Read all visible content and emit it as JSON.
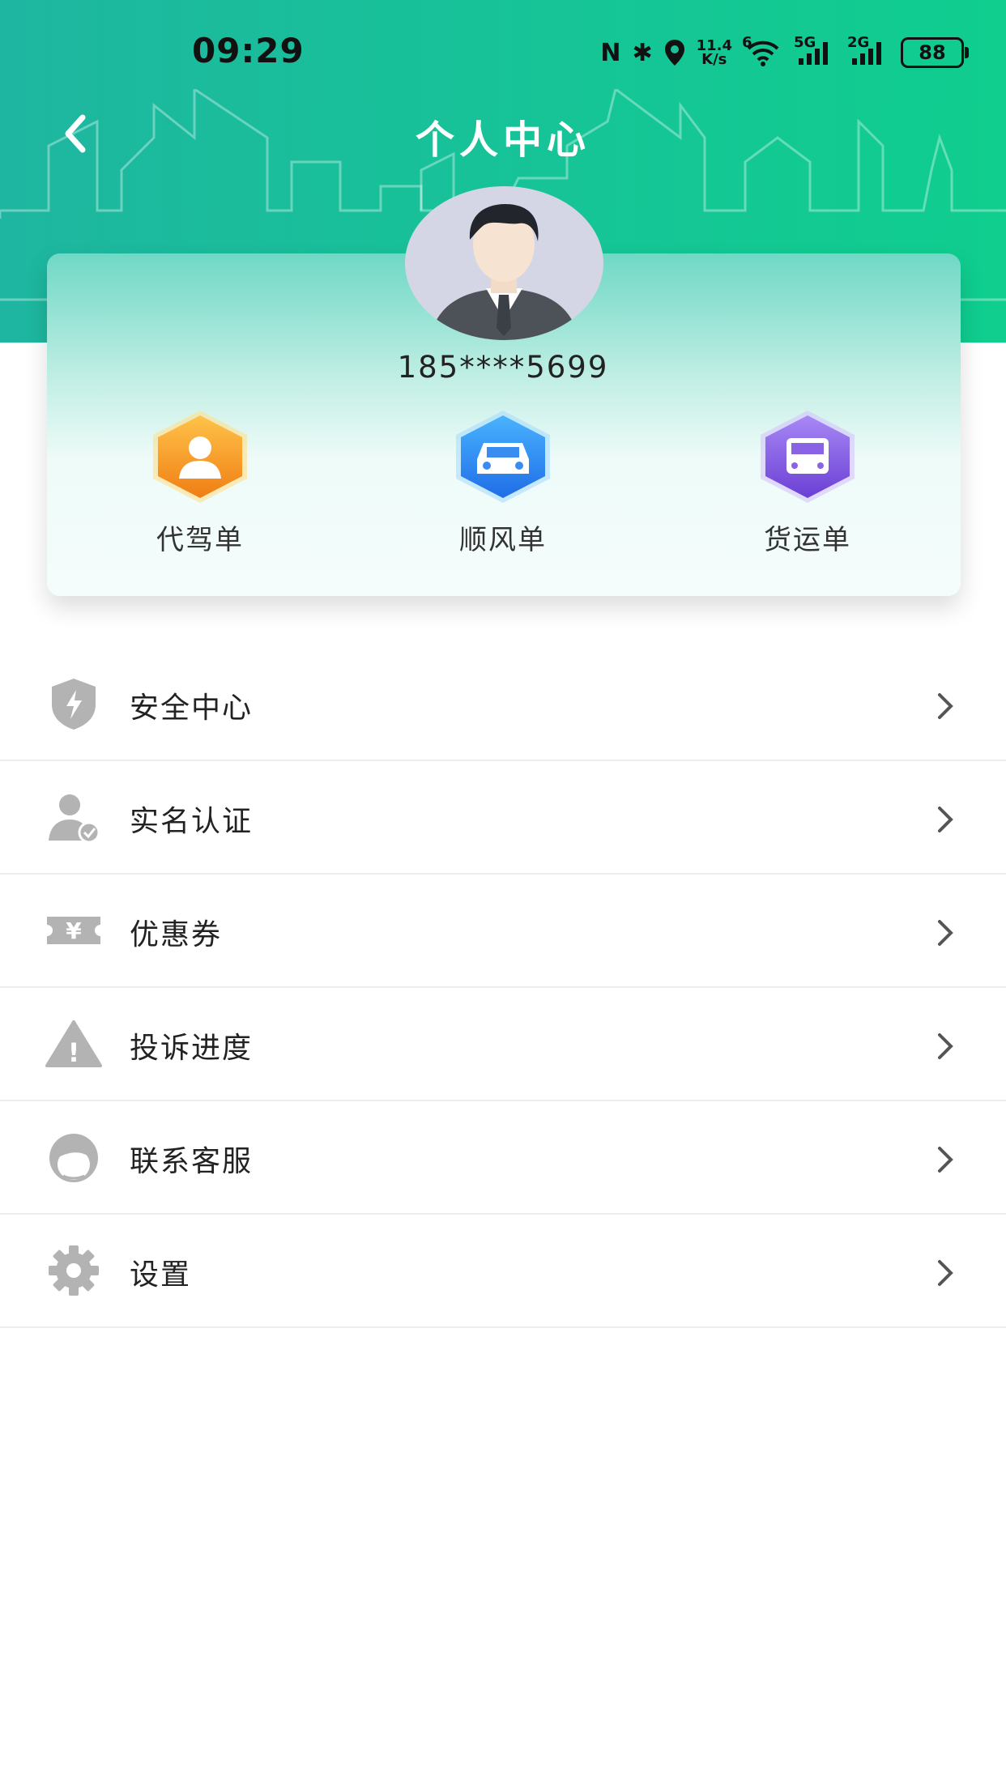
{
  "status_bar": {
    "time": "09:29",
    "nfc": "N",
    "bluetooth": "✱",
    "net_speed_value": "11.4",
    "net_speed_unit": "K/s",
    "wifi_label": "6",
    "sim1_label": "5G",
    "sim2_label": "2G",
    "battery": "88"
  },
  "header": {
    "title": "个人中心"
  },
  "profile": {
    "phone": "185****5699"
  },
  "orders": [
    {
      "label": "代驾单",
      "icon": "driver-icon",
      "color": "#f59a1c"
    },
    {
      "label": "顺风单",
      "icon": "car-icon",
      "color": "#2f8ff0"
    },
    {
      "label": "货运单",
      "icon": "truck-icon",
      "color": "#7a55d8"
    }
  ],
  "menu": [
    {
      "label": "安全中心",
      "icon": "shield-icon"
    },
    {
      "label": "实名认证",
      "icon": "verified-user-icon"
    },
    {
      "label": "优惠券",
      "icon": "coupon-icon",
      "icon_text": "¥"
    },
    {
      "label": "投诉进度",
      "icon": "warning-icon",
      "icon_text": "!"
    },
    {
      "label": "联系客服",
      "icon": "customer-service-icon"
    },
    {
      "label": "设置",
      "icon": "gear-icon"
    }
  ],
  "colors": {
    "header_gradient_start": "#1eb6a0",
    "header_gradient_end": "#0fce8e",
    "icon_gray": "#b3b3b3"
  }
}
